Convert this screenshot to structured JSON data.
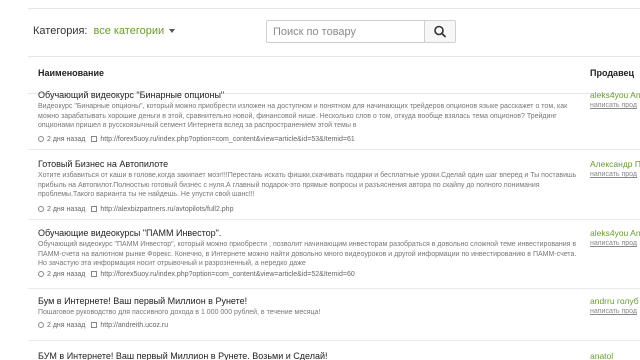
{
  "filter": {
    "label": "Категория:",
    "value": "все категории"
  },
  "search": {
    "placeholder": "Поиск по товару"
  },
  "table": {
    "col_name": "Наименование",
    "col_seller": "Продавец"
  },
  "rows": [
    {
      "title": "Обучающий видеокурс \"Бинарные опционы\"",
      "desc": "Видеокурс \"Бинарные опционы\", который можно приобрести изложен на доступном и понятном для начинающих трейдеров опционов языке расскажет о том, как можно зарабатывать хорошие деньги в этой, сравнительно новой, финансовой нише. Несколько слов о том, откуда вообще взялась тема опционов? Трейдинг опционами пришел в русскоязычный сегмент Интернета вслед за распространением этой темы в",
      "time": "2 дня назад",
      "link": "http://forex5uoy.ru/index.php?option=com_content&view=article&id=53&Itemid=61",
      "seller": "aleks4you An",
      "write": "написать прод"
    },
    {
      "title": "Готовый Бизнес на Автопилоте",
      "desc": "Хотите избавиться от каши в голове,когда закипает мозг!!!Перестань искать фишки,скачивать подарки и бесплатные уроки.Сделай один шаг вперед и Ты поставишь прибыль на Автопилот.Полностью готовый бизнес с нуля.А главный подарок-это прямые вопросы и разъяснения автора по скайпу до полного понимания проблемы.Такого варианта ты не найдешь. Не упусти свой шанс!!!",
      "time": "2 дня назад",
      "link": "http://alexbizpartners.ru/avtopilots/full2.php",
      "seller": "Александр П",
      "write": "написать прод"
    },
    {
      "title": "Обучающие видеокурсы \"ПАММ Инвестор\".",
      "desc": "Обучающий видеокурс \"ПАММ Инвестор\", который можно приобрести , позволит начинающим инвесторам разобраться в довольно сложной теме инвестирования в ПАММ-счета на валютном рынке Форекс. Конечно, в Интернете можно найти довольно много видеоуроков и другой информации по инвестированию в ПАММ-счета. Но зачастую эта информация носит отрывочный и разрозненный, а нередко даже",
      "time": "2 дня назад",
      "link": "http://forex5uoy.ru/index.php?option=com_content&view=article&id=52&Itemid=60",
      "seller": "aleks4you An",
      "write": "написать прод"
    },
    {
      "title": "Бум в Интернете! Ваш первый Миллион в Рунете!",
      "desc": "Пошаговое руководство для пассивного дохода в 1 000 000 рублей, в течение месяца!",
      "time": "2 дня назад",
      "link": "http://andreith.ucoz.ru",
      "seller": "andrru голуб",
      "write": "написать прод"
    },
    {
      "title": "БУМ в Интернете! Ваш первый Миллион в Рунете. Возьми и Сделай!",
      "seller": "anatol"
    }
  ]
}
